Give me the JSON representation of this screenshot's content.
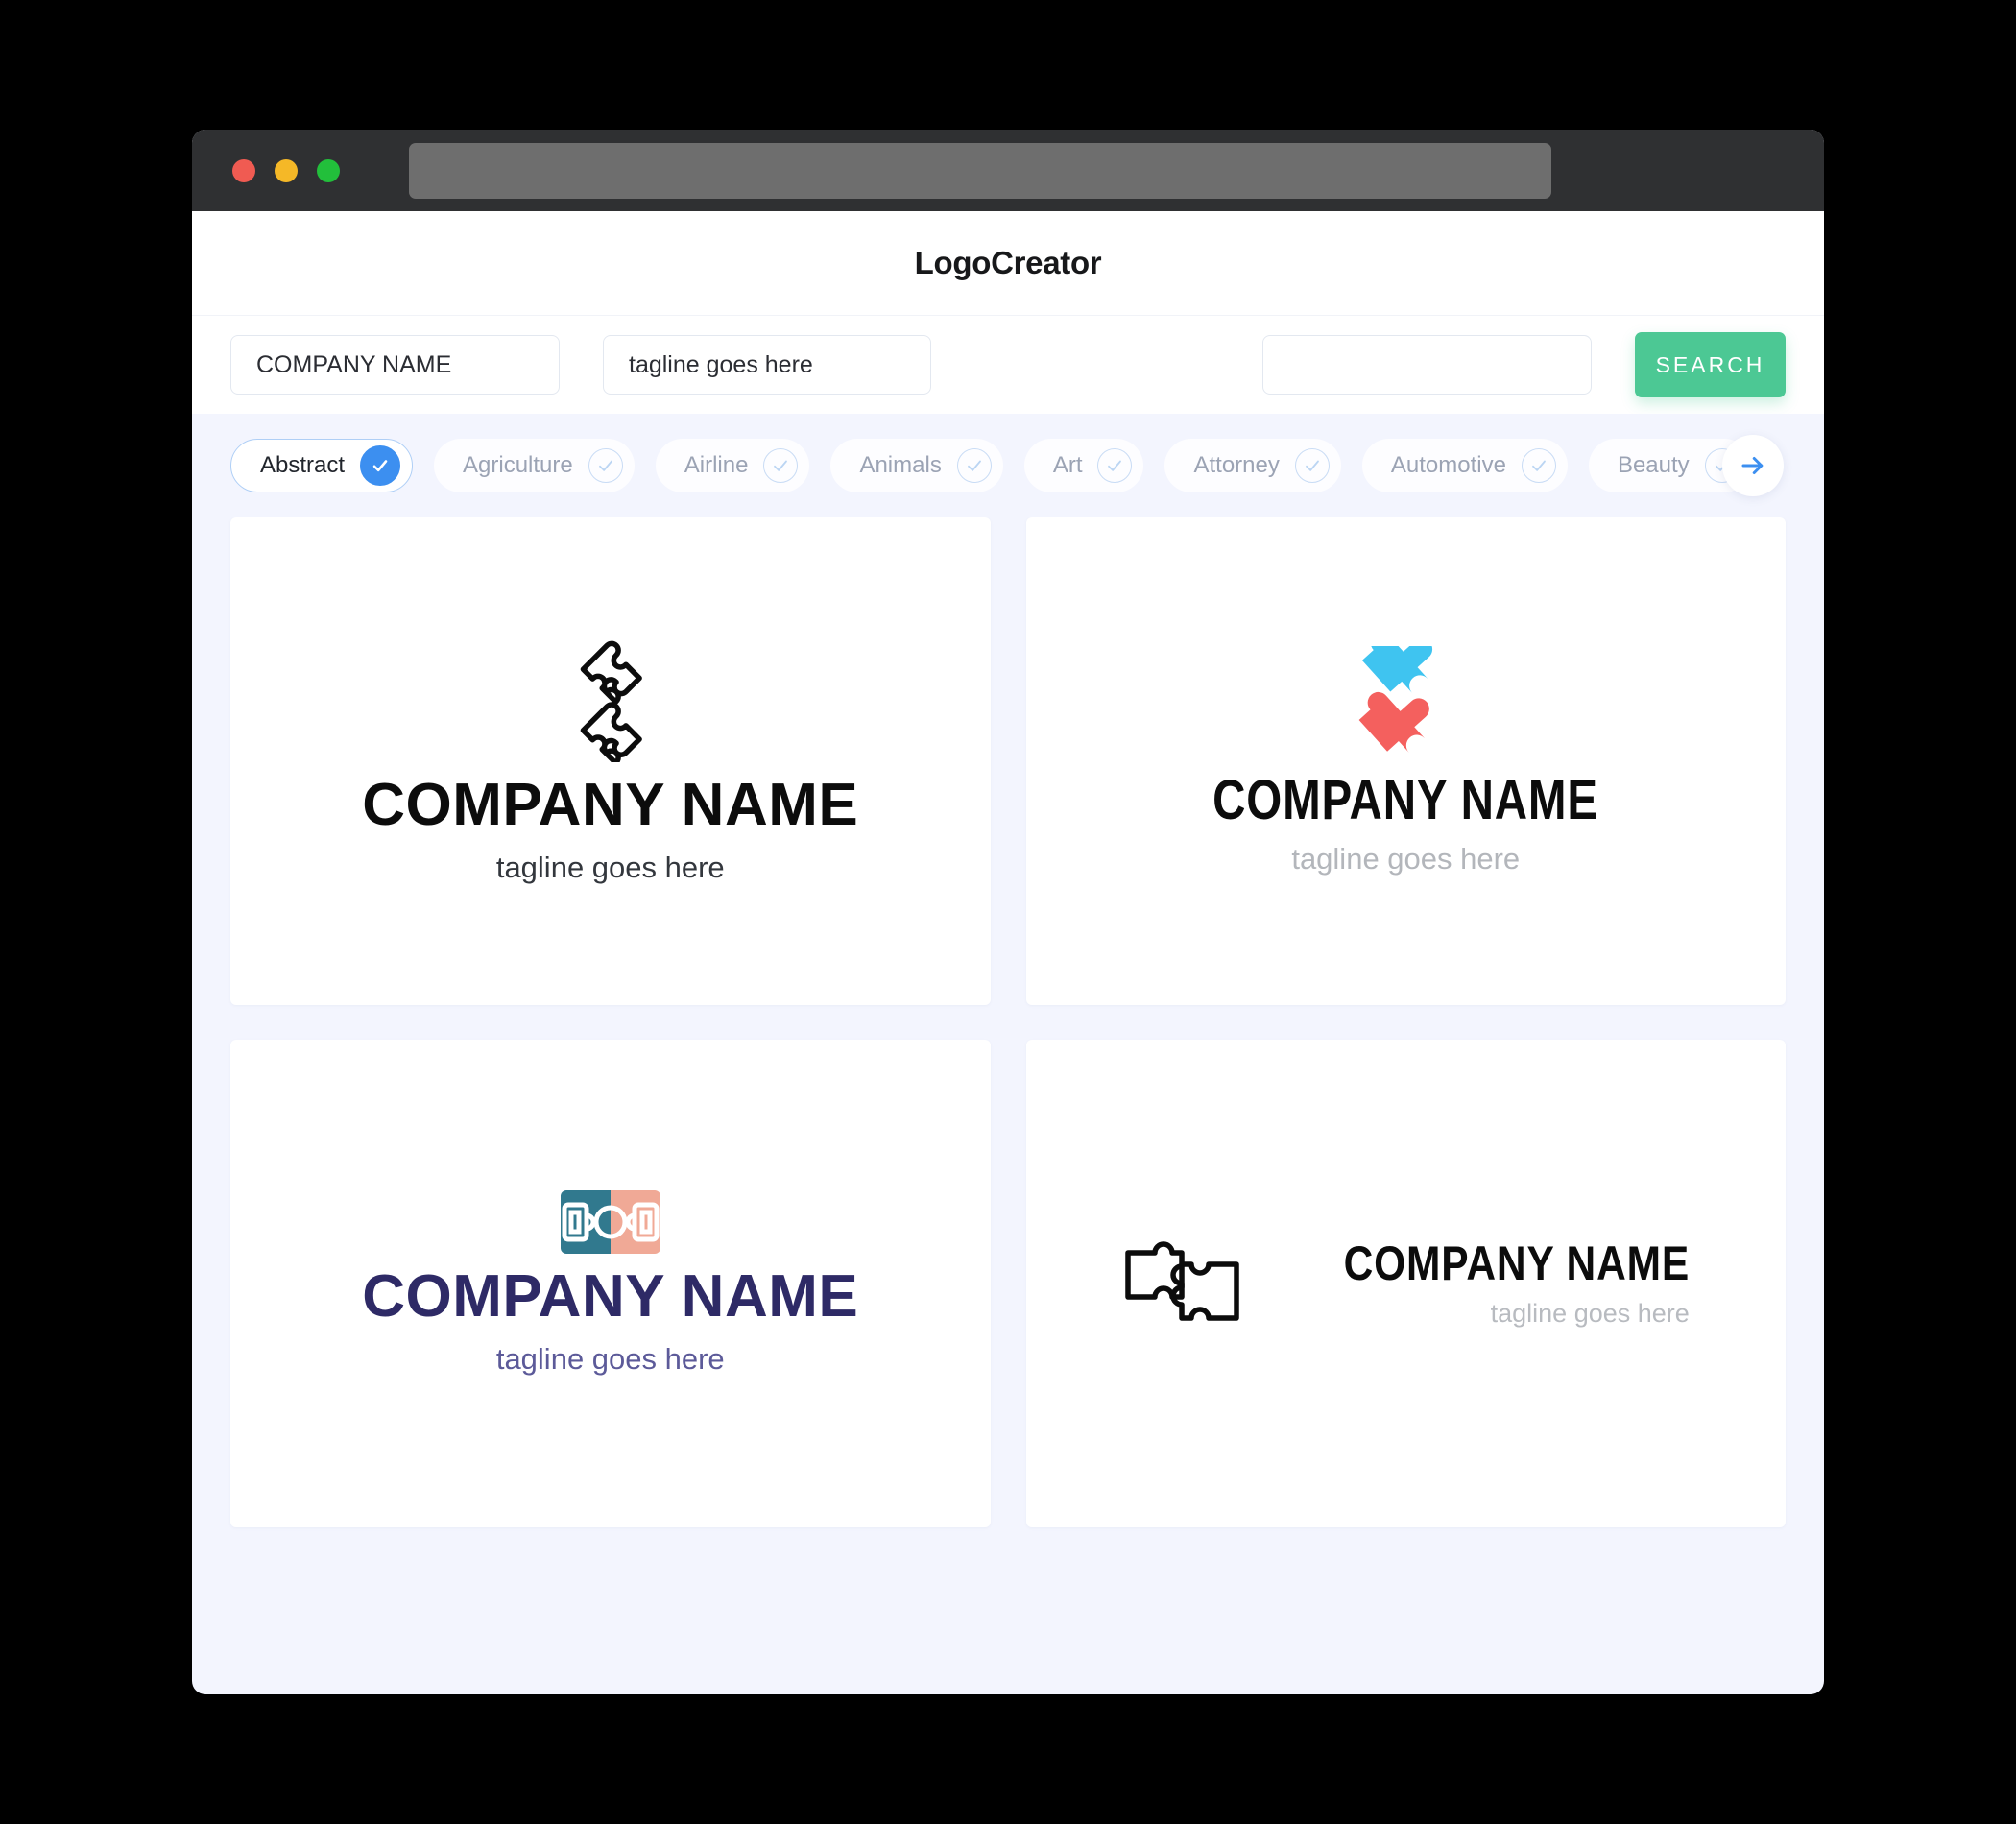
{
  "window": {
    "traffic_lights": [
      {
        "name": "close",
        "color": "#F05B52"
      },
      {
        "name": "minimize",
        "color": "#F5B827"
      },
      {
        "name": "maximize",
        "color": "#22BF3B"
      }
    ],
    "url_value": ""
  },
  "header": {
    "title": "LogoCreator"
  },
  "search": {
    "company_name_value": "COMPANY NAME",
    "company_name_placeholder": "COMPANY NAME",
    "tagline_value": "tagline goes here",
    "tagline_placeholder": "tagline goes here",
    "keyword_value": "",
    "keyword_placeholder": "",
    "button_label": "SEARCH",
    "button_color": "#4CC894"
  },
  "categories": {
    "accent_color": "#3C8FF0",
    "next_icon": "arrow-right-icon",
    "items": [
      {
        "label": "Abstract",
        "selected": true
      },
      {
        "label": "Agriculture",
        "selected": false
      },
      {
        "label": "Airline",
        "selected": false
      },
      {
        "label": "Animals",
        "selected": false
      },
      {
        "label": "Art",
        "selected": false
      },
      {
        "label": "Attorney",
        "selected": false
      },
      {
        "label": "Automotive",
        "selected": false
      },
      {
        "label": "Beauty",
        "selected": false
      }
    ]
  },
  "logos": [
    {
      "icon": "puzzle-two-pieces-outline-icon",
      "name": "COMPANY NAME",
      "tagline": "tagline goes here",
      "name_color": "#0C0C0C",
      "tagline_color": "#33373D",
      "layout": "stacked"
    },
    {
      "icon": "puzzle-two-pieces-color-icon",
      "name": "COMPANY NAME",
      "tagline": "tagline goes here",
      "name_color": "#0C0C0C",
      "tagline_color": "#B3B6BB",
      "icon_colors": {
        "red": "#F4605E",
        "blue": "#3FC4F0"
      },
      "layout": "stacked"
    },
    {
      "icon": "soccer-field-split-icon",
      "name": "COMPANY NAME",
      "tagline": "tagline goes here",
      "name_color": "#2E2A66",
      "tagline_color": "#5C5A99",
      "icon_colors": {
        "teal": "#31798E",
        "salmon": "#F0A996"
      },
      "layout": "stacked"
    },
    {
      "icon": "puzzle-interlock-horizontal-outline-icon",
      "name": "COMPANY NAME",
      "tagline": "tagline goes here",
      "name_color": "#0C0C0C",
      "tagline_color": "#B8BBC0",
      "layout": "horizontal"
    }
  ]
}
